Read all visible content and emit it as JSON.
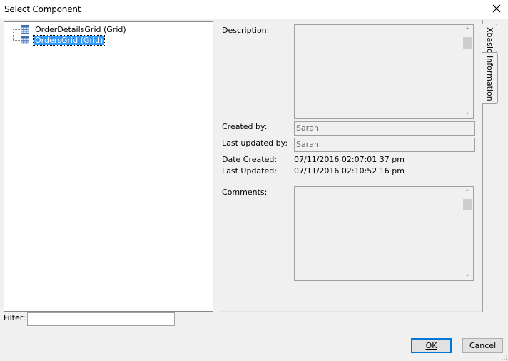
{
  "window": {
    "title": "Select Component"
  },
  "tree": {
    "items": [
      {
        "label": "OrderDetailsGrid (Grid)",
        "selected": false,
        "icon": "grid-component-icon"
      },
      {
        "label": "OrdersGrid (Grid)",
        "selected": true,
        "icon": "grid-component-icon"
      }
    ]
  },
  "filter": {
    "label": "Filter:",
    "value": ""
  },
  "info": {
    "description_label": "Description:",
    "description_value": "",
    "created_by_label": "Created by:",
    "created_by_value": "Sarah",
    "last_updated_by_label": "Last updated by:",
    "last_updated_by_value": "Sarah",
    "date_created_label": "Date Created:",
    "date_created_value": "07/11/2016 02:07:01 37 pm",
    "last_updated_label": "Last Updated:",
    "last_updated_value": "07/11/2016 02:10:52 16 pm",
    "comments_label": "Comments:",
    "comments_value": ""
  },
  "tabs": [
    {
      "label": "Xbasic",
      "active": false
    },
    {
      "label": "Information",
      "active": true
    }
  ],
  "buttons": {
    "ok": "OK",
    "cancel": "Cancel"
  },
  "colors": {
    "selection": "#3399ff",
    "default_button_border": "#0078d7"
  }
}
